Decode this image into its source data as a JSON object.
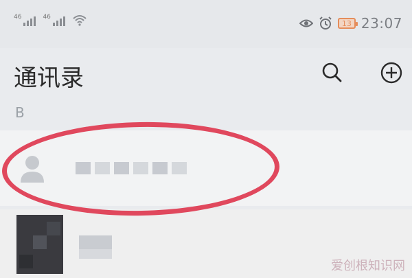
{
  "status_bar": {
    "sim1_tag": "46",
    "sim2_tag": "46",
    "battery_level": "13",
    "time": "23:07",
    "icons": [
      "signal-icon",
      "signal-icon",
      "wifi-icon",
      "eye-icon",
      "alarm-icon",
      "battery-icon"
    ]
  },
  "header": {
    "title": "通讯录",
    "search_icon": "search-icon",
    "add_icon": "plus-circle-icon"
  },
  "section": {
    "letter": "B"
  },
  "contacts": [
    {
      "name": "",
      "avatar": "default-avatar-icon",
      "highlighted": true
    },
    {
      "name": "",
      "avatar": "photo-avatar"
    }
  ],
  "watermark": "爱创根知识网",
  "colors": {
    "highlight": "#e0485d",
    "battery": "#e58d5b"
  }
}
